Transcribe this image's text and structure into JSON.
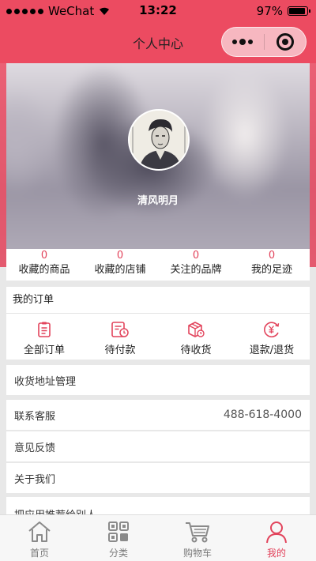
{
  "status_bar": {
    "carrier": "WeChat",
    "time": "13:22",
    "battery_percent": "97%",
    "battery_level": 0.97
  },
  "nav": {
    "title": "个人中心"
  },
  "profile": {
    "username": "清风明月"
  },
  "stats": [
    {
      "count": "0",
      "label": "收藏的商品"
    },
    {
      "count": "0",
      "label": "收藏的店铺"
    },
    {
      "count": "0",
      "label": "关注的品牌"
    },
    {
      "count": "0",
      "label": "我的足迹"
    }
  ],
  "orders": {
    "title": "我的订单",
    "items": [
      {
        "label": "全部订单",
        "icon": "clipboard-icon"
      },
      {
        "label": "待付款",
        "icon": "payment-pending-icon"
      },
      {
        "label": "待收货",
        "icon": "package-icon"
      },
      {
        "label": "退款/退货",
        "icon": "refund-icon"
      }
    ]
  },
  "menu": {
    "address": "收货地址管理",
    "service": "联系客服",
    "service_phone": "488-618-4000",
    "feedback": "意见反馈",
    "about": "关于我们",
    "recommend": "把应用推荐给别人"
  },
  "tabbar": [
    {
      "label": "首页",
      "icon": "home-icon"
    },
    {
      "label": "分类",
      "icon": "category-icon"
    },
    {
      "label": "购物车",
      "icon": "cart-icon"
    },
    {
      "label": "我的",
      "icon": "user-icon"
    }
  ],
  "colors": {
    "brand": "#ec4b61",
    "accent": "#e2445c",
    "tab_inactive": "#7a7a7a"
  }
}
